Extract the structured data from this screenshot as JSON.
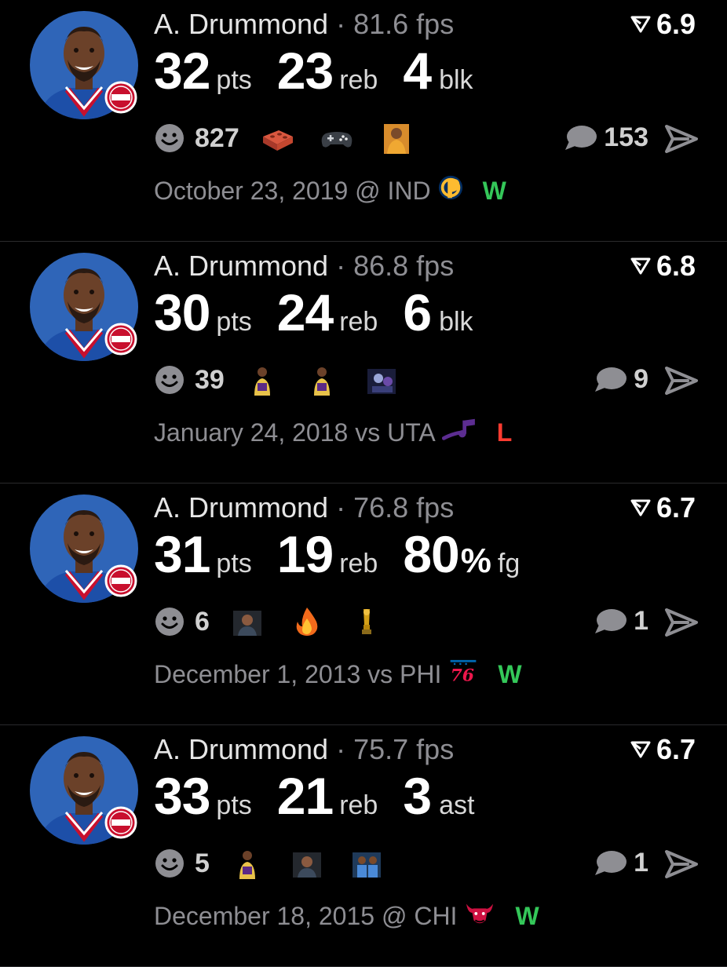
{
  "colors": {
    "background": "#000000",
    "text_primary": "#ffffff",
    "text_secondary": "#8e8e93",
    "win": "#34c759",
    "loss": "#ff3b30",
    "jersey_blue": "#1d4fa8",
    "pistons_red": "#c8102e"
  },
  "cards": [
    {
      "player": "A. Drummond",
      "separator": "·",
      "fps": "81.6 fps",
      "rating": "6.9",
      "stat1": {
        "value": "32",
        "unit": "pts"
      },
      "stat2": {
        "value": "23",
        "unit": "reb"
      },
      "stat3": {
        "value": "4",
        "pct": "",
        "unit": "blk"
      },
      "reaction_count": "827",
      "reactions": [
        "brick-emoji",
        "game-controller-emoji",
        "meme-image"
      ],
      "comment_count": "153",
      "date": "October 23, 2019 @ IND",
      "team_logo": "pacers-logo",
      "result": "W"
    },
    {
      "player": "A. Drummond",
      "separator": "·",
      "fps": "86.8 fps",
      "rating": "6.8",
      "stat1": {
        "value": "30",
        "unit": "pts"
      },
      "stat2": {
        "value": "24",
        "unit": "reb"
      },
      "stat3": {
        "value": "6",
        "pct": "",
        "unit": "blk"
      },
      "reaction_count": "39",
      "reactions": [
        "player-image",
        "player-image",
        "cartoon-image"
      ],
      "comment_count": "9",
      "date": "January 24, 2018 vs UTA",
      "team_logo": "jazz-logo",
      "result": "L"
    },
    {
      "player": "A. Drummond",
      "separator": "·",
      "fps": "76.8 fps",
      "rating": "6.7",
      "stat1": {
        "value": "31",
        "unit": "pts"
      },
      "stat2": {
        "value": "19",
        "unit": "reb"
      },
      "stat3": {
        "value": "80",
        "pct": "%",
        "unit": "fg"
      },
      "reaction_count": "6",
      "reactions": [
        "person-image",
        "fire-emoji",
        "trophy-emoji"
      ],
      "comment_count": "1",
      "date": "December 1, 2013 vs PHI",
      "team_logo": "76ers-logo",
      "result": "W"
    },
    {
      "player": "A. Drummond",
      "separator": "·",
      "fps": "75.7 fps",
      "rating": "6.7",
      "stat1": {
        "value": "33",
        "unit": "pts"
      },
      "stat2": {
        "value": "21",
        "unit": "reb"
      },
      "stat3": {
        "value": "3",
        "pct": "",
        "unit": "ast"
      },
      "reaction_count": "5",
      "reactions": [
        "player-image",
        "person-image",
        "players-image"
      ],
      "comment_count": "1",
      "date": "December 18, 2015 @ CHI",
      "team_logo": "bulls-logo",
      "result": "W"
    }
  ]
}
